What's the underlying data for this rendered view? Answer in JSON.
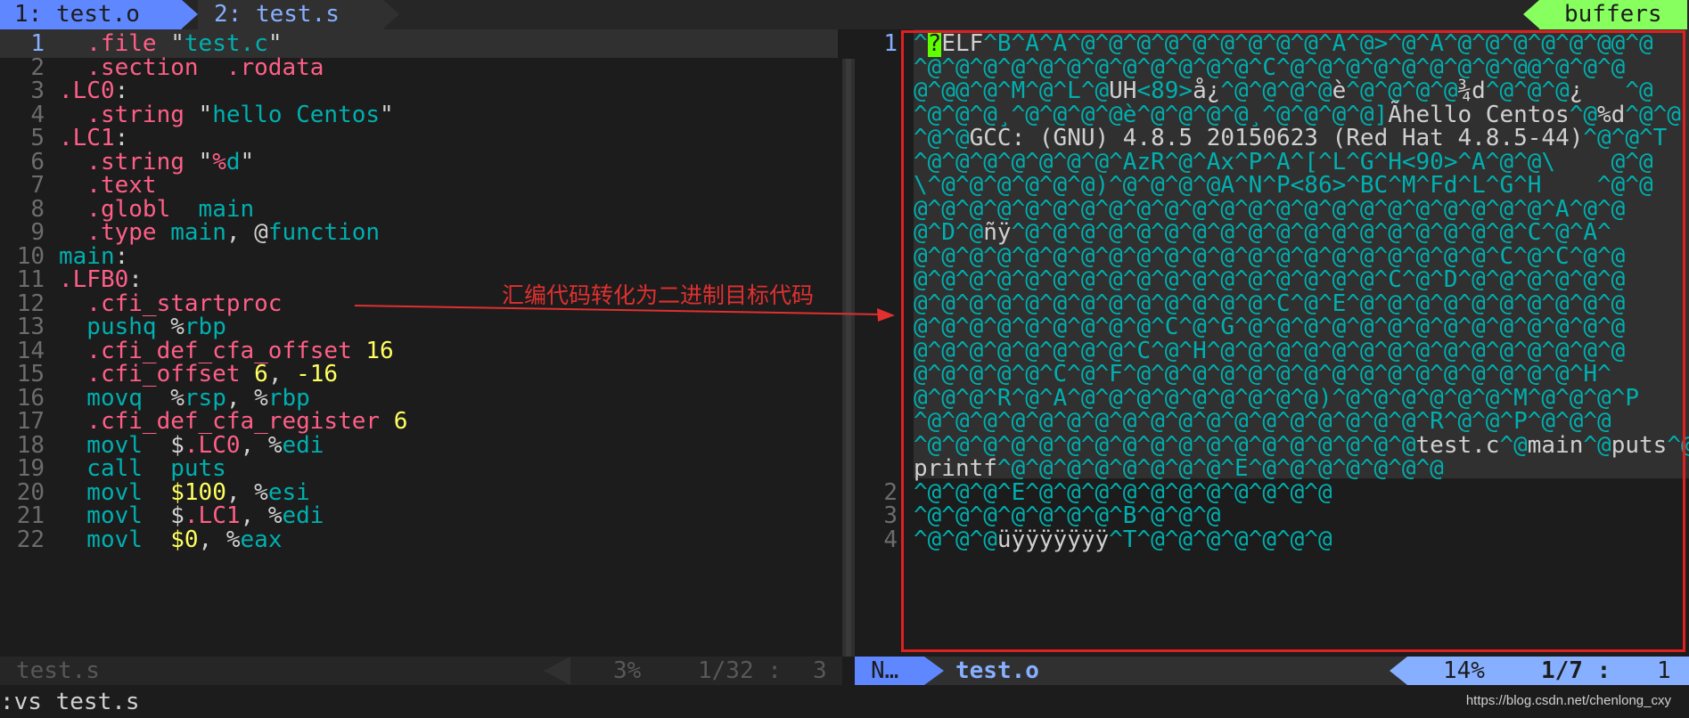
{
  "tabs": [
    {
      "label": "1: test.o"
    },
    {
      "label": "2: test.s"
    }
  ],
  "buffers_label": "buffers",
  "left_pane": {
    "lines": [
      {
        "n": "1",
        "parts": [
          [
            "dir",
            "  .file "
          ],
          [
            "txt",
            "\""
          ],
          [
            "str",
            "test.c"
          ],
          [
            "txt",
            "\""
          ]
        ]
      },
      {
        "n": "2",
        "parts": [
          [
            "dir",
            "  .section  .rodata"
          ]
        ]
      },
      {
        "n": "3",
        "parts": [
          [
            "dir",
            ".LC0"
          ],
          [
            "txt",
            ":"
          ]
        ]
      },
      {
        "n": "4",
        "parts": [
          [
            "dir",
            "  .string "
          ],
          [
            "txt",
            "\""
          ],
          [
            "str",
            "hello Centos"
          ],
          [
            "txt",
            "\""
          ]
        ]
      },
      {
        "n": "5",
        "parts": [
          [
            "dir",
            ".LC1"
          ],
          [
            "txt",
            ":"
          ]
        ]
      },
      {
        "n": "6",
        "parts": [
          [
            "dir",
            "  .string "
          ],
          [
            "txt",
            "\""
          ],
          [
            "dir",
            "%"
          ],
          [
            "str",
            "d"
          ],
          [
            "txt",
            "\""
          ]
        ]
      },
      {
        "n": "7",
        "parts": [
          [
            "dir",
            "  .text"
          ]
        ]
      },
      {
        "n": "8",
        "parts": [
          [
            "dir",
            "  .globl  "
          ],
          [
            "str",
            "main"
          ]
        ]
      },
      {
        "n": "9",
        "parts": [
          [
            "dir",
            "  .type "
          ],
          [
            "str",
            "main"
          ],
          [
            "txt",
            ", @"
          ],
          [
            "str",
            "function"
          ]
        ]
      },
      {
        "n": "10",
        "parts": [
          [
            "str",
            "main"
          ],
          [
            "txt",
            ":"
          ]
        ]
      },
      {
        "n": "11",
        "parts": [
          [
            "dir",
            ".LFB0"
          ],
          [
            "txt",
            ":"
          ]
        ]
      },
      {
        "n": "12",
        "parts": [
          [
            "dir",
            "  .cfi_startproc"
          ]
        ]
      },
      {
        "n": "13",
        "parts": [
          [
            "ins",
            "  pushq "
          ],
          [
            "txt",
            "%"
          ],
          [
            "reg",
            "rbp"
          ]
        ]
      },
      {
        "n": "14",
        "parts": [
          [
            "dir",
            "  .cfi_def_cfa_offset "
          ],
          [
            "num",
            "16"
          ]
        ]
      },
      {
        "n": "15",
        "parts": [
          [
            "dir",
            "  .cfi_offset "
          ],
          [
            "num",
            "6"
          ],
          [
            "txt",
            ", "
          ],
          [
            "num",
            "-16"
          ]
        ]
      },
      {
        "n": "16",
        "parts": [
          [
            "ins",
            "  movq  "
          ],
          [
            "txt",
            "%"
          ],
          [
            "reg",
            "rsp"
          ],
          [
            "txt",
            ", %"
          ],
          [
            "reg",
            "rbp"
          ]
        ]
      },
      {
        "n": "17",
        "parts": [
          [
            "dir",
            "  .cfi_def_cfa_register "
          ],
          [
            "num",
            "6"
          ]
        ]
      },
      {
        "n": "18",
        "parts": [
          [
            "ins",
            "  movl  "
          ],
          [
            "txt",
            "$"
          ],
          [
            "dir",
            ".LC0"
          ],
          [
            "txt",
            ", %"
          ],
          [
            "reg",
            "edi"
          ]
        ]
      },
      {
        "n": "19",
        "parts": [
          [
            "ins",
            "  call  puts"
          ]
        ]
      },
      {
        "n": "20",
        "parts": [
          [
            "ins",
            "  movl  "
          ],
          [
            "num",
            "$100"
          ],
          [
            "txt",
            ", %"
          ],
          [
            "reg",
            "esi"
          ]
        ]
      },
      {
        "n": "21",
        "parts": [
          [
            "ins",
            "  movl  "
          ],
          [
            "txt",
            "$"
          ],
          [
            "dir",
            ".LC1"
          ],
          [
            "txt",
            ", %"
          ],
          [
            "reg",
            "edi"
          ]
        ]
      },
      {
        "n": "22",
        "parts": [
          [
            "ins",
            "  movl  "
          ],
          [
            "num",
            "$0"
          ],
          [
            "txt",
            ", %"
          ],
          [
            "reg",
            "eax"
          ]
        ]
      }
    ]
  },
  "right_pane": {
    "line_numbers": [
      {
        "n": "1",
        "row": 0
      },
      {
        "n": "2",
        "row": 19
      },
      {
        "n": "3",
        "row": 20
      },
      {
        "n": "4",
        "row": 21
      }
    ],
    "rows": [
      [
        [
          "c",
          "^"
        ],
        [
          "cur",
          "?"
        ],
        [
          "w",
          "ELF"
        ],
        [
          "c",
          "^B^A^A^@^@^@^@^@^@^@^@^@^A^@>^@^A^@^@^@^@^@^@@^@"
        ]
      ],
      [
        [
          "c",
          "^@^@^@^@^@^@^@^@^@^@^@^@^C^@^@^@^@^@^@^@^@^@@^@^@^@"
        ]
      ],
      [
        [
          "c",
          "@^@@^@^M^@^L^@"
        ],
        [
          "w",
          "UH"
        ],
        [
          "c",
          "<89>"
        ],
        [
          "w",
          "å¿"
        ],
        [
          "c",
          "^@^@^@^@"
        ],
        [
          "w",
          "è"
        ],
        [
          "c",
          "^@^@^@^@"
        ],
        [
          "w",
          "¾d"
        ],
        [
          "c",
          "^@^@^@"
        ],
        [
          "w",
          "¿"
        ],
        [
          "c",
          "   ^@"
        ]
      ],
      [
        [
          "c",
          "^@^@^@¸^@^@^@^@è^@^@^@^@¸^@^@^@^@]"
        ],
        [
          "w",
          "Ãhello Centos"
        ],
        [
          "c",
          "^@"
        ],
        [
          "w",
          "%d"
        ],
        [
          "c",
          "^@^@"
        ]
      ],
      [
        [
          "c",
          "^@^@"
        ],
        [
          "w",
          "GCC: (GNU) 4.8.5 20150623 (Red Hat 4.8.5-44)"
        ],
        [
          "c",
          "^@^@^T"
        ]
      ],
      [
        [
          "c",
          "^@^@^@^@^@^@^@^AzR^@^Ax^P^A^[^L^G^H<90>^A^@^@\\    @^@"
        ]
      ],
      [
        [
          "c",
          "\\^@^@^@^@^@^@)^@^@^@^@A^N^P<86>^BC^M^Fd^L^G^H    ^@^@"
        ]
      ],
      [
        [
          "c",
          "@^@^@^@^@^@^@^@^@^@^@^@^@^@^@^@^@^@^@^@^@^@^@^A^@^@"
        ]
      ],
      [
        [
          "c",
          "@^D^@"
        ],
        [
          "w",
          "ñÿ"
        ],
        [
          "c",
          "^@^@^@^@^@^@^@^@^@^@^@^@^@^@^@^@^@^@^C^@^A^"
        ]
      ],
      [
        [
          "c",
          "@^@^@^@^@^@^@^@^@^@^@^@^@^@^@^@^@^@^@^@^@^C^@^C^@^@"
        ]
      ],
      [
        [
          "c",
          "@^@^@^@^@^@^@^@^@^@^@^@^@^@^@^@^@^C^@^D^@^@^@^@^@^@"
        ]
      ],
      [
        [
          "c",
          "@^@^@^@^@^@^@^@^@^@^@^@^@^C^@^E^@^@^@^@^@^@^@^@^@^@"
        ]
      ],
      [
        [
          "c",
          "@^@^@^@^@^@^@^@^@^C^@^G^@^@^@^@^@^@^@^@^@^@^@^@^@^@"
        ]
      ],
      [
        [
          "c",
          "@^@^@^@^@^@^@^@^C^@^H^@^@^@^@^@^@^@^@^@^@^@^@^@^@^@"
        ]
      ],
      [
        [
          "c",
          "@^@^@^@^@^C^@^F^@^@^@^@^@^@^@^@^@^@^@^@^@^@^@^@^H^"
        ]
      ],
      [
        [
          "c",
          "@^@^@^R^@^A^@^@^@^@^@^@^@^@^@)^@^@^@^@^@^@^M^@^@^@^P"
        ]
      ],
      [
        [
          "c",
          "^@^@^@^@^@^@^@^@^@^@^@^@^@^@^@^@^@^@^R^@^@^P^@^@^@"
        ]
      ],
      [
        [
          "c",
          "^@^@^@^@^@^@^@^@^@^@^@^@^@^@^@^@^@^@"
        ],
        [
          "w",
          "test.c"
        ],
        [
          "c",
          "^@"
        ],
        [
          "w",
          "main"
        ],
        [
          "c",
          "^@"
        ],
        [
          "w",
          "puts"
        ],
        [
          "c",
          "^@"
        ]
      ],
      [
        [
          "w",
          "printf"
        ],
        [
          "c",
          "^@^@^@^@^@^@^@^@^E^@^@^@^@^@^@^@"
        ]
      ],
      [
        [
          "c",
          "^@^@^@^E^@^@^@^@^@^@^@^@^@^@^@"
        ]
      ],
      [
        [
          "c",
          "^@^@^@^@^@^@^@^B^@^@^@"
        ]
      ],
      [
        [
          "c",
          "^@^@^@"
        ],
        [
          "w",
          "üÿÿÿÿÿÿÿ"
        ],
        [
          "c",
          "^T^@^@^@^@^@^@^@"
        ]
      ]
    ]
  },
  "status_left": {
    "file": "test.s",
    "percent": "3%",
    "position": "1/32 :",
    "column": "3"
  },
  "status_right": {
    "mode": "N…",
    "file": "test.o",
    "percent": "14%",
    "position": "1/7 :",
    "column": "1"
  },
  "command_line": ":vs test.s",
  "annotation": "汇编代码转化为二进制目标代码",
  "watermark": "https://blog.csdn.net/chenlong_cxy",
  "colors": {
    "directive": "#ff5f87",
    "identifier": "#00afaf",
    "number": "#ffff5f",
    "annotation": "#e03030",
    "tab_active": "#5f87ff",
    "buffers": "#87ff5f"
  }
}
